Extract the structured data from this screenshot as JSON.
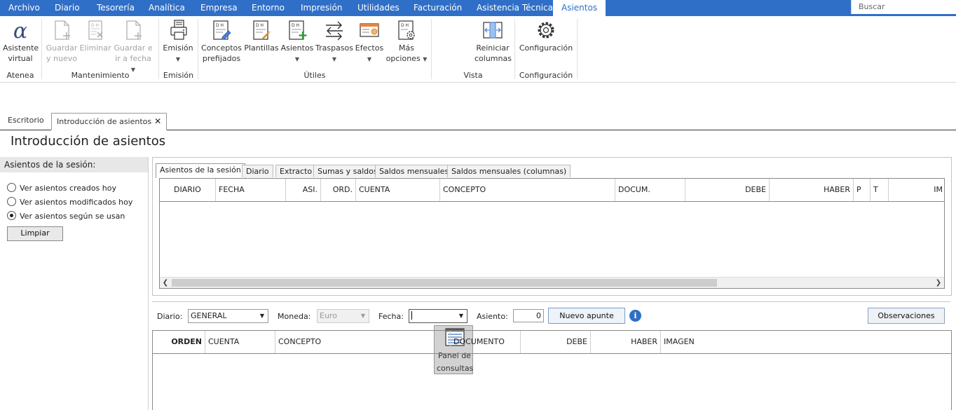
{
  "menu": {
    "items": [
      "Archivo",
      "Diario",
      "Tesorería",
      "Analítica",
      "Empresa",
      "Entorno",
      "Impresión",
      "Utilidades",
      "Facturación",
      "Asistencia Técnica"
    ],
    "active": "Asientos",
    "search_placeholder": "Buscar"
  },
  "ribbon": {
    "atenea": {
      "label": "Atenea",
      "asistente_l1": "Asistente",
      "asistente_l2": "virtual"
    },
    "mantenimiento": {
      "label": "Mantenimiento",
      "guardar_l1": "Guardar",
      "guardar_l2": "y nuevo",
      "eliminar": "Eliminar",
      "guardar_fecha_l1": "Guardar e",
      "guardar_fecha_l2": "ir a fecha"
    },
    "emision": {
      "label": "Emisión",
      "button": "Emisión"
    },
    "utiles": {
      "label": "Útiles",
      "conceptos_l1": "Conceptos",
      "conceptos_l2": "prefijados",
      "plantillas": "Plantillas",
      "asientos": "Asientos",
      "traspasos": "Traspasos",
      "efectos": "Efectos",
      "mas_l1": "Más",
      "mas_l2": "opciones"
    },
    "vista": {
      "label": "Vista",
      "panel_l1": "Panel de",
      "panel_l2": "consultas",
      "reiniciar_l1": "Reiniciar",
      "reiniciar_l2": "columnas"
    },
    "configuracion": {
      "label": "Configuración",
      "button": "Configuración"
    }
  },
  "doc_tabs": {
    "escritorio": "Escritorio",
    "intro": "Introducción de asientos"
  },
  "page_title": "Introducción de asientos",
  "left_panel": {
    "header": "Asientos de la sesión:",
    "options": [
      "Ver asientos creados hoy",
      "Ver asientos modificados hoy",
      "Ver asientos según se usan"
    ],
    "selected_index": 2,
    "clear_button": "Limpiar"
  },
  "upper_tabs": [
    "Asientos de la sesión",
    "Diario",
    "Extracto",
    "Sumas y saldos",
    "Saldos mensuales",
    "Saldos mensuales (columnas)"
  ],
  "upper_grid_columns": [
    "DIARIO",
    "FECHA",
    "ASI.",
    "ORD.",
    "CUENTA",
    "CONCEPTO",
    "DOCUM.",
    "DEBE",
    "HABER",
    "P",
    "T",
    "IM"
  ],
  "form": {
    "diario_label": "Diario:",
    "diario_value": "GENERAL",
    "moneda_label": "Moneda:",
    "moneda_value": "Euro",
    "fecha_label": "Fecha:",
    "fecha_value": "",
    "asiento_label": "Asiento:",
    "asiento_value": "0",
    "nuevo_apunte": "Nuevo apunte",
    "info": "i",
    "observaciones": "Observaciones"
  },
  "lower_grid_columns": [
    "ORDEN",
    "CUENTA",
    "CONCEPTO",
    "DOCUMENTO",
    "DEBE",
    "HABER",
    "IMAGEN"
  ],
  "colors": {
    "menu_bg": "#2f6fc7",
    "menu_text": "#ffffff",
    "accent": "#2f6fc7"
  },
  "icons": {
    "asistente": "alpha-icon",
    "guardar": "document-add-icon",
    "eliminar": "document-delete-icon",
    "emision": "printer-icon",
    "conceptos": "ledger-pencil-icon",
    "plantillas": "ledger-template-icon",
    "asientos": "ledger-add-icon",
    "traspasos": "transfer-arrows-icon",
    "efectos": "effect-card-icon",
    "mas": "ledger-gear-icon",
    "panel": "panel-icon",
    "reiniciar": "columns-reset-icon",
    "config": "gear-icon"
  }
}
